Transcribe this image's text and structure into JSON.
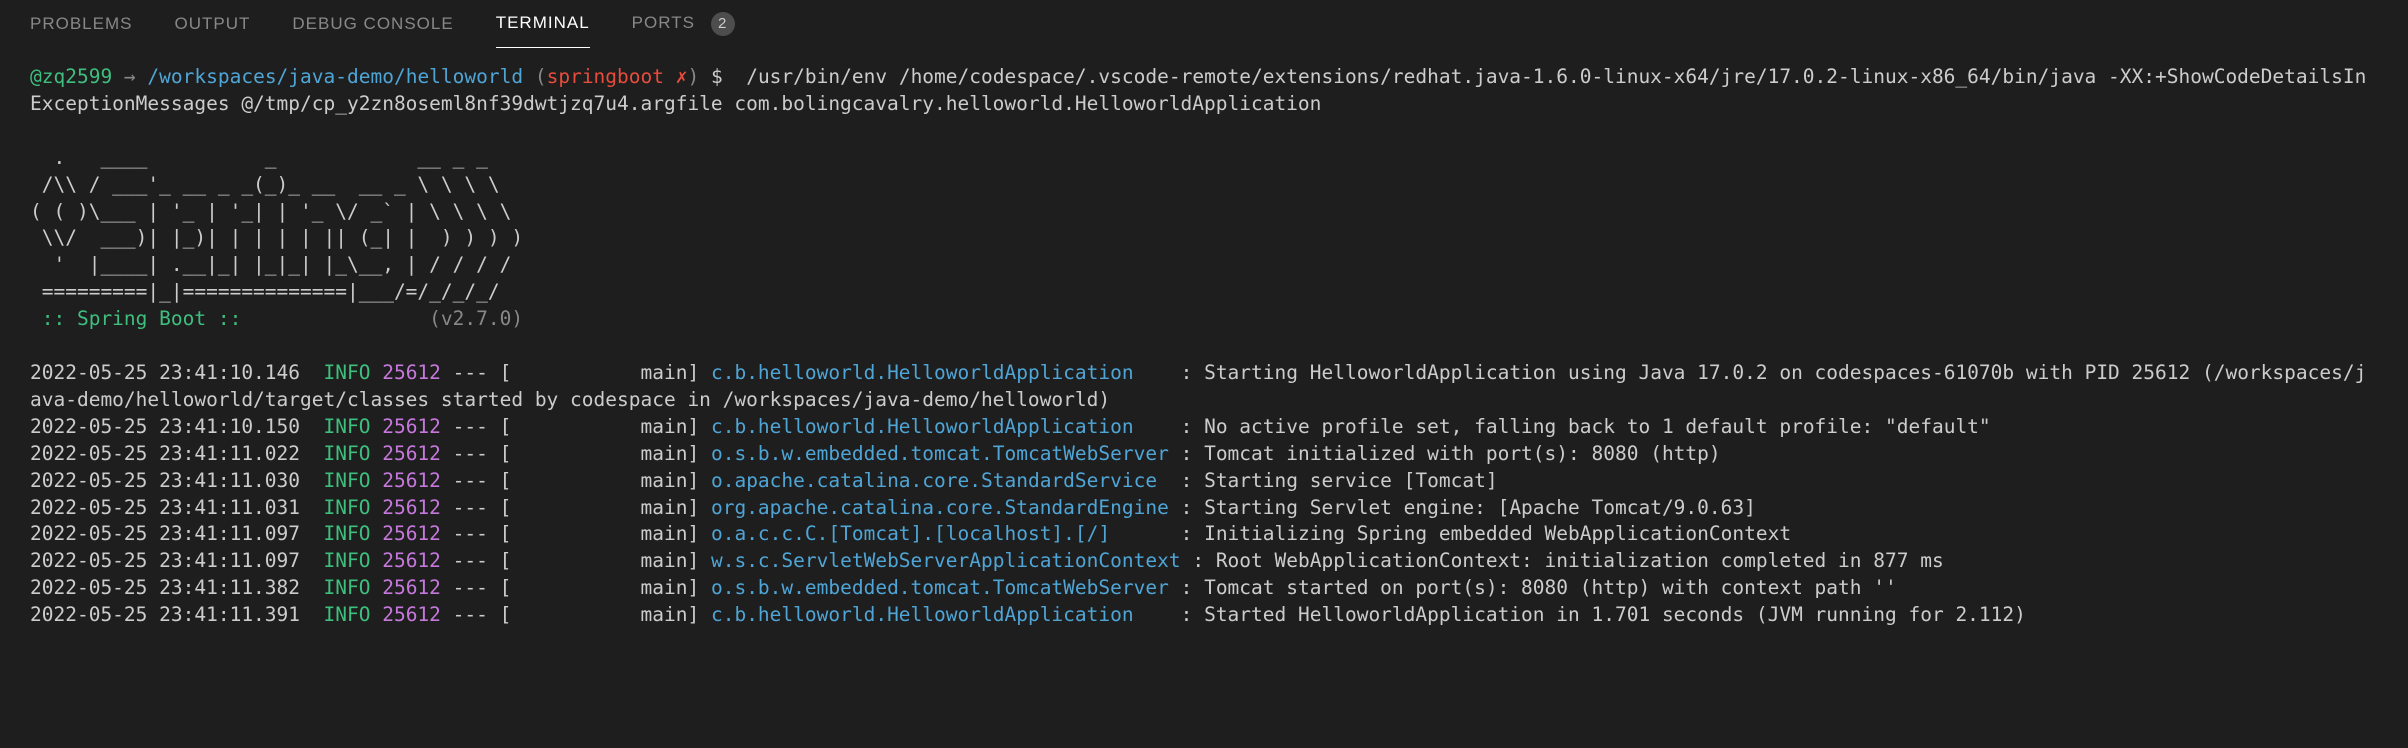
{
  "tabs": {
    "problems": "PROBLEMS",
    "output": "OUTPUT",
    "debug": "DEBUG CONSOLE",
    "terminal": "TERMINAL",
    "ports": "PORTS",
    "ports_badge": "2"
  },
  "prompt": {
    "user": "@zq2599",
    "arrow": "→",
    "path": "/workspaces/java-demo/helloworld",
    "branch": "springboot",
    "x": "✗",
    "dollar": "$"
  },
  "command": "/usr/bin/env /home/codespace/.vscode-remote/extensions/redhat.java-1.6.0-linux-x64/jre/17.0.2-linux-x86_64/bin/java -XX:+ShowCodeDetailsInExceptionMessages @/tmp/cp_y2zn8oseml8nf39dwtjzq7u4.argfile com.bolingcavalry.helloworld.HelloworldApplication",
  "ascii_art": "  .   ____          _            __ _ _\n /\\\\ / ___'_ __ _ _(_)_ __  __ _ \\ \\ \\ \\\n( ( )\\___ | '_ | '_| | '_ \\/ _` | \\ \\ \\ \\\n \\\\/  ___)| |_)| | | | | || (_| |  ) ) ) )\n  '  |____| .__|_| |_|_| |_\\__, | / / / /\n =========|_|==============|___/=/_/_/_/",
  "spring_boot_label": " :: Spring Boot :: ",
  "spring_version": "(v2.7.0)",
  "logs": [
    {
      "ts": "2022-05-25 23:41:10.146",
      "level": "INFO",
      "pid": "25612",
      "thread": "main",
      "logger": "c.b.helloworld.HelloworldApplication   ",
      "msg": "Starting HelloworldApplication using Java 17.0.2 on codespaces-61070b with PID 25612 (/workspaces/java-demo/helloworld/target/classes started by codespace in /workspaces/java-demo/helloworld)"
    },
    {
      "ts": "2022-05-25 23:41:10.150",
      "level": "INFO",
      "pid": "25612",
      "thread": "main",
      "logger": "c.b.helloworld.HelloworldApplication   ",
      "msg": "No active profile set, falling back to 1 default profile: \"default\""
    },
    {
      "ts": "2022-05-25 23:41:11.022",
      "level": "INFO",
      "pid": "25612",
      "thread": "main",
      "logger": "o.s.b.w.embedded.tomcat.TomcatWebServer",
      "msg": "Tomcat initialized with port(s): 8080 (http)"
    },
    {
      "ts": "2022-05-25 23:41:11.030",
      "level": "INFO",
      "pid": "25612",
      "thread": "main",
      "logger": "o.apache.catalina.core.StandardService ",
      "msg": "Starting service [Tomcat]"
    },
    {
      "ts": "2022-05-25 23:41:11.031",
      "level": "INFO",
      "pid": "25612",
      "thread": "main",
      "logger": "org.apache.catalina.core.StandardEngine",
      "msg": "Starting Servlet engine: [Apache Tomcat/9.0.63]"
    },
    {
      "ts": "2022-05-25 23:41:11.097",
      "level": "INFO",
      "pid": "25612",
      "thread": "main",
      "logger": "o.a.c.c.C.[Tomcat].[localhost].[/]     ",
      "msg": "Initializing Spring embedded WebApplicationContext"
    },
    {
      "ts": "2022-05-25 23:41:11.097",
      "level": "INFO",
      "pid": "25612",
      "thread": "main",
      "logger": "w.s.c.ServletWebServerApplicationContext",
      "msg": "Root WebApplicationContext: initialization completed in 877 ms"
    },
    {
      "ts": "2022-05-25 23:41:11.382",
      "level": "INFO",
      "pid": "25612",
      "thread": "main",
      "logger": "o.s.b.w.embedded.tomcat.TomcatWebServer",
      "msg": "Tomcat started on port(s): 8080 (http) with context path ''"
    },
    {
      "ts": "2022-05-25 23:41:11.391",
      "level": "INFO",
      "pid": "25612",
      "thread": "main",
      "logger": "c.b.helloworld.HelloworldApplication   ",
      "msg": "Started HelloworldApplication in 1.701 seconds (JVM running for 2.112)"
    }
  ]
}
